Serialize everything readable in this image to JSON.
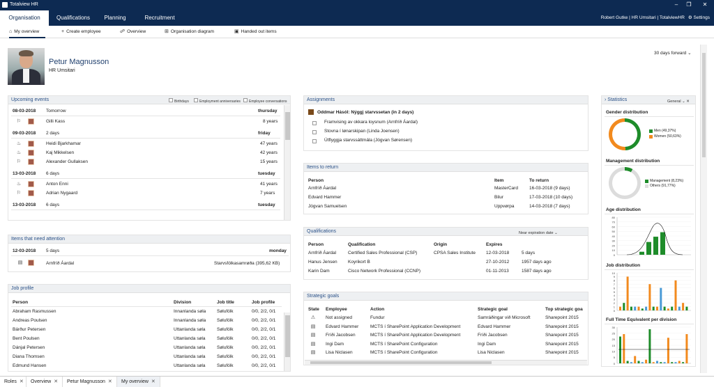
{
  "app": {
    "title": "Totalview HR"
  },
  "menu": {
    "tabs": [
      "Organisation",
      "Qualifications",
      "Planning",
      "Recruitment"
    ],
    "user": "Robert Gutke | HR Umsitari | TotalviewHR",
    "settings": "Settings"
  },
  "toolbar": {
    "items": [
      "My overview",
      "Create employee",
      "Overview",
      "Organisation diagram",
      "Handed out items"
    ]
  },
  "profile": {
    "name": "Petur Magnusson",
    "role": "HR Umsitari"
  },
  "period": {
    "label": "30 days forward"
  },
  "upcoming": {
    "title": "Upcoming events",
    "filters": [
      "Birthdays",
      "Employment anniversaries",
      "Employee conversations"
    ],
    "groups": [
      {
        "date": "08-03-2018",
        "rel": "Tomorrow",
        "day": "thursday",
        "items": [
          {
            "name": "Gilli Kass",
            "val": "8 years"
          }
        ]
      },
      {
        "date": "09-03-2018",
        "rel": "2 days",
        "day": "friday",
        "items": [
          {
            "name": "Heidi Bjarkhamar",
            "val": "47 years"
          },
          {
            "name": "Kaj Mikkelsen",
            "val": "42 years"
          },
          {
            "name": "Alexander Gullaksen",
            "val": "15 years"
          }
        ]
      },
      {
        "date": "13-03-2018",
        "rel": "6 days",
        "day": "tuesday",
        "items": [
          {
            "name": "Anton Enni",
            "val": "41 years"
          },
          {
            "name": "Adrian Nygaard",
            "val": "7 years"
          }
        ]
      },
      {
        "date": "13-03-2018",
        "rel": "6 days",
        "day": "tuesday",
        "items": []
      }
    ]
  },
  "attention": {
    "title": "Items that need attention",
    "date": "12-03-2018",
    "rel": "5 days",
    "day": "monday",
    "name": "Arnfríð Áardal",
    "doc": "Starvsfólkasamrøða (395,62 KB)"
  },
  "jobprofile": {
    "title": "Job profile",
    "headers": [
      "Person",
      "Division",
      "Job title",
      "Job profile"
    ],
    "rows": [
      [
        "Abraham Rasmussen",
        "Innanlanda søla",
        "Sølufólk",
        "0/0, 2/2, 0/1"
      ],
      [
        "Andreas Poulsen",
        "Innanlanda søla",
        "Sølufólk",
        "0/0, 2/2, 0/1"
      ],
      [
        "Bárður Petersen",
        "Uttanlanda søla",
        "Sølufólk",
        "0/0, 2/2, 0/1"
      ],
      [
        "Bent Poulsen",
        "Uttanlanda søla",
        "Sølufólk",
        "0/0, 2/2, 0/1"
      ],
      [
        "Dánjal Petersen",
        "Uttanlanda søla",
        "Sølufólk",
        "0/0, 2/2, 0/1"
      ],
      [
        "Diana Thomsen",
        "Uttanlanda søla",
        "Sølufólk",
        "0/0, 2/2, 0/1"
      ],
      [
        "Edmund Hansen",
        "Uttanlanda søla",
        "Sølufólk",
        "0/0, 2/2, 0/1"
      ]
    ]
  },
  "assignments": {
    "title": "Assignments",
    "heading": "Oddmar Hásól: Nýggj starvssetan (in 2 days)",
    "tasks": [
      "Framvising av okkara loysnum (Arnfríð Áardal)",
      "Stovna í lønarskipan (Linda Joensen)",
      "Útflyggja starvssáttmála (Jógvan Sørensen)"
    ]
  },
  "itemsreturn": {
    "title": "Items to return",
    "headers": [
      "Person",
      "Item",
      "To return"
    ],
    "rows": [
      [
        "Arnfríð Áardal",
        "MasterCard",
        "16-03-2018 (9 days)"
      ],
      [
        "Edvard Hammer",
        "Bilur",
        "17-03-2018 (10 days)"
      ],
      [
        "Jógvan Samuelsen",
        "Uppvørpa",
        "14-03-2018 (7 days)"
      ]
    ]
  },
  "qualifications": {
    "title": "Qualifications",
    "filter": "Near expiration date",
    "headers": [
      "Person",
      "Qualification",
      "Origin",
      "Expires"
    ],
    "rows": [
      [
        "Arnfríð Áardal",
        "Certified Sales Professional (CSP)",
        "CPSA Sales Institute",
        "12-03-2018",
        "5 days"
      ],
      [
        "Hanus Jensen",
        "Koyrikort B",
        "",
        "27-10-2012",
        "1957 days ago"
      ],
      [
        "Karin Dam",
        "Cisco Network Professional (CCNP)",
        "",
        "01-11-2013",
        "1587 days ago"
      ]
    ]
  },
  "goals": {
    "title": "Strategic goals",
    "headers": [
      "State",
      "Employee",
      "Action",
      "Strategic goal",
      "Top strategic goa"
    ],
    "rows": [
      [
        "Not assigned",
        "Fundur",
        "Samráðingar við Microsoft",
        "Sharepoint 2015"
      ],
      [
        "Edvard Hammer",
        "MCTS í SharePoint Application Development",
        "Edvard Hammer",
        "Sharepoint 2015"
      ],
      [
        "Fríði Jacobsen",
        "MCTS í SharePoint Application Development",
        "Fríði Jacobsen",
        "Sharepoint 2015"
      ],
      [
        "Ingi Dam",
        "MCTS í SharePoint Configuration",
        "Ingi Dam",
        "Sharepoint 2015"
      ],
      [
        "Lisa Niclasen",
        "MCTS í SharePoint Configuration",
        "Lisa Niclasen",
        "Sharepoint 2015"
      ]
    ]
  },
  "stats": {
    "title": "Statistics",
    "dropdown": "General",
    "gender": {
      "title": "Gender distribution",
      "men": "Men (49,37%)",
      "women": "Women (50,63%)",
      "men_pct": 49.37
    },
    "mgmt": {
      "title": "Management distribution",
      "mgmt": "Management (8,23%)",
      "others": "Others (91,77%)",
      "mgmt_pct": 8.23
    },
    "age": {
      "title": "Age distribution",
      "ticks": [
        "80",
        "70",
        "60",
        "50",
        "40",
        "30",
        "20",
        "10",
        "0"
      ]
    },
    "job": {
      "title": "Job distribution",
      "ticks": [
        "10",
        "9",
        "8",
        "7",
        "6",
        "5",
        "4",
        "3",
        "2",
        "1",
        "0"
      ]
    },
    "fte": {
      "title": "Full Time Equivalent per division",
      "ticks": [
        "30",
        "25",
        "20",
        "15",
        "10",
        "5",
        "0"
      ]
    }
  },
  "bottomtabs": [
    "Roles",
    "Overview",
    "Petur Magnusson",
    "My overview"
  ],
  "colors": {
    "navy": "#0d2a52",
    "green": "#1e8c2a",
    "orange": "#f28a1e",
    "blue": "#4a9ad6"
  }
}
